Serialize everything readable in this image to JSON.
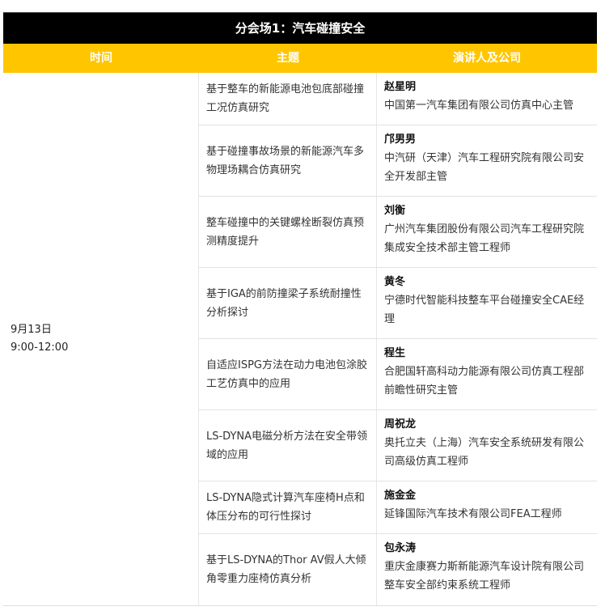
{
  "session_title": "分会场1：汽车碰撞安全",
  "columns": {
    "time": "时间",
    "topic": "主题",
    "speaker": "演讲人及公司"
  },
  "time": {
    "date": "9月13日",
    "range": "9:00-12:00"
  },
  "rows": [
    {
      "topic": "基于整车的新能源电池包底部碰撞工况仿真研究",
      "name": "赵星明",
      "company": "中国第一汽车集团有限公司仿真中心主管"
    },
    {
      "topic": "基于碰撞事故场景的新能源汽车多物理场耦合仿真研究",
      "name": "邝男男",
      "company": "中汽研（天津）汽车工程研究院有限公司安全开发部主管"
    },
    {
      "topic": "整车碰撞中的关键螺栓断裂仿真预测精度提升",
      "name": "刘衡",
      "company": "广州汽车集团股份有限公司汽车工程研究院集成安全技术部主管工程师"
    },
    {
      "topic": "基于IGA的前防撞梁子系统耐撞性分析探讨",
      "name": "黄冬",
      "company": "宁德时代智能科技整车平台碰撞安全CAE经理"
    },
    {
      "topic": "自适应ISPG方法在动力电池包涂胶工艺仿真中的应用",
      "name": "程生",
      "company": "合肥国轩高科动力能源有限公司仿真工程部前瞻性研究主管"
    },
    {
      "topic": "LS-DYNA电磁分析方法在安全带领域的应用",
      "name": "周祝龙",
      "company": "奥托立夫（上海）汽车安全系统研发有限公司高级仿真工程师"
    },
    {
      "topic": "LS-DYNA隐式计算汽车座椅H点和体压分布的可行性探讨",
      "name": "施金金",
      "company": "延锋国际汽车技术有限公司FEA工程师"
    },
    {
      "topic": "基于LS-DYNA的Thor AV假人大倾角零重力座椅仿真分析",
      "name": "包永涛",
      "company": "重庆金康赛力斯新能源汽车设计院有限公司整车安全部约束系统工程师"
    }
  ],
  "colors": {
    "title_bg": "#000000",
    "header_bg": "#ffc600",
    "text": "#333333"
  }
}
